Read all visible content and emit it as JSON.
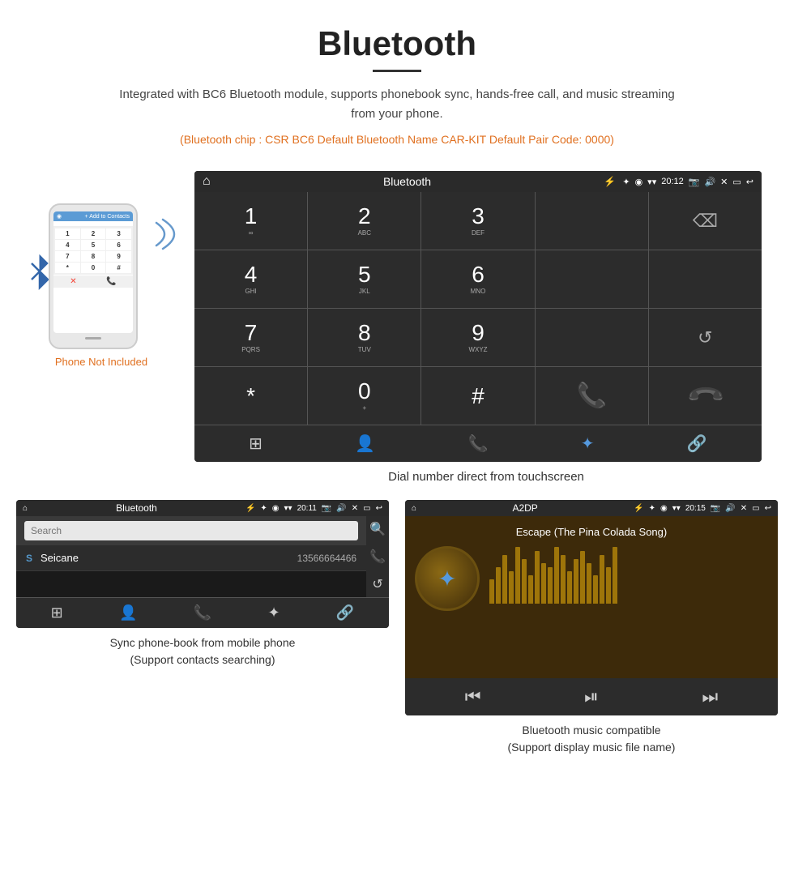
{
  "header": {
    "title": "Bluetooth",
    "description": "Integrated with BC6 Bluetooth module, supports phonebook sync, hands-free call, and music streaming from your phone.",
    "chip_info": "(Bluetooth chip : CSR BC6    Default Bluetooth Name CAR-KIT    Default Pair Code: 0000)"
  },
  "phone_label": "Phone Not Included",
  "dial_screen": {
    "app_name": "Bluetooth",
    "time": "20:12",
    "keys": [
      {
        "num": "1",
        "sub": ""
      },
      {
        "num": "2",
        "sub": "ABC"
      },
      {
        "num": "3",
        "sub": "DEF"
      },
      {
        "num": "",
        "sub": ""
      },
      {
        "num": "⌫",
        "sub": ""
      },
      {
        "num": "4",
        "sub": "GHI"
      },
      {
        "num": "5",
        "sub": "JKL"
      },
      {
        "num": "6",
        "sub": "MNO"
      },
      {
        "num": "",
        "sub": ""
      },
      {
        "num": "",
        "sub": ""
      },
      {
        "num": "7",
        "sub": "PQRS"
      },
      {
        "num": "8",
        "sub": "TUV"
      },
      {
        "num": "9",
        "sub": "WXYZ"
      },
      {
        "num": "",
        "sub": ""
      },
      {
        "num": "↺",
        "sub": ""
      },
      {
        "num": "*",
        "sub": ""
      },
      {
        "num": "0",
        "sub": "+"
      },
      {
        "num": "#",
        "sub": ""
      },
      {
        "num": "📞",
        "sub": ""
      },
      {
        "num": "📞",
        "sub": "end"
      }
    ]
  },
  "dial_caption": "Dial number direct from touchscreen",
  "phonebook": {
    "app_name": "Bluetooth",
    "time": "20:11",
    "search_placeholder": "Search",
    "contact": {
      "letter": "S",
      "name": "Seicane",
      "phone": "13566664466"
    }
  },
  "phonebook_caption": "Sync phone-book from mobile phone\n(Support contacts searching)",
  "music": {
    "app_name": "A2DP",
    "time": "20:15",
    "song_title": "Escape (The Pina Colada Song)"
  },
  "music_caption": "Bluetooth music compatible\n(Support display music file name)",
  "icons": {
    "home": "⌂",
    "usb": "⚡",
    "bluetooth": "✦",
    "camera": "📷",
    "volume": "🔊",
    "close": "✕",
    "window": "▭",
    "back": "↩",
    "gps": "◉",
    "signal": "▾",
    "grid": "⊞",
    "person": "👤",
    "phone": "📞",
    "bt_symbol": "Ƀ",
    "link": "🔗",
    "search": "🔍",
    "sync": "↺",
    "prev": "⏮",
    "play": "⏵",
    "next": "⏭",
    "pause": "⏸",
    "play_pause": "⏯"
  },
  "visualizer_bars": [
    30,
    45,
    60,
    40,
    70,
    55,
    35,
    65,
    50,
    45,
    70,
    60,
    40,
    55,
    65,
    50,
    35,
    60,
    45,
    70
  ]
}
